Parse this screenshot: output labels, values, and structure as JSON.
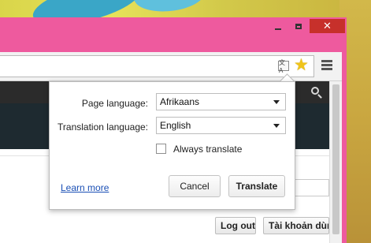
{
  "window": {
    "minimize_glyph": "minimize-icon",
    "maximize_glyph": "maximize-icon",
    "close_label": "✕"
  },
  "toolbar": {
    "translate_icon_text": "文A",
    "star_glyph": "★"
  },
  "page": {
    "logout_label": "Log out",
    "account_label": "Tài khoản dùn"
  },
  "translate_bubble": {
    "page_language_label": "Page language:",
    "page_language_value": "Afrikaans",
    "translation_language_label": "Translation language:",
    "translation_language_value": "English",
    "always_translate_label": "Always translate",
    "always_translate_checked": false,
    "learn_more_label": "Learn more",
    "cancel_label": "Cancel",
    "translate_label": "Translate"
  },
  "colors": {
    "frame": "#ee5a9e",
    "close_button": "#c7302b",
    "link": "#1a4fb5",
    "star": "#f0c419"
  }
}
